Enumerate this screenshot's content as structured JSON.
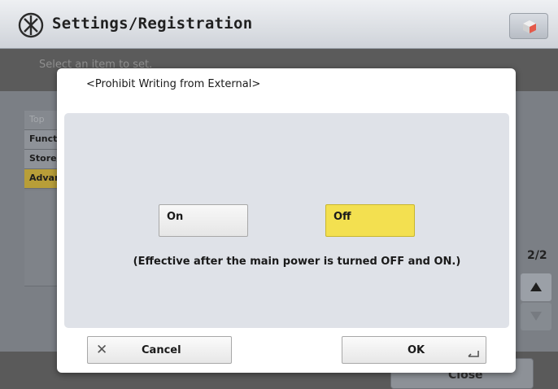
{
  "header": {
    "title": "Settings/Registration",
    "icon": "settings-registration-icon",
    "right_button_icon": "cube-icon"
  },
  "subheader": {
    "text": "Select an item to set."
  },
  "breadcrumbs": [
    {
      "label": "Top"
    },
    {
      "label": "Function Settings"
    },
    {
      "label": "Store/Access Files"
    },
    {
      "label": "Advanced Box"
    }
  ],
  "pagination": {
    "indicator": "2/2"
  },
  "footer": {
    "close_label": "Close"
  },
  "dialog": {
    "title": "<Prohibit Writing from External>",
    "options": [
      {
        "label": "On",
        "selected": false
      },
      {
        "label": "Off",
        "selected": true
      }
    ],
    "note": "(Effective after the main power is turned OFF and ON.)",
    "cancel_label": "Cancel",
    "ok_label": "OK"
  },
  "colors": {
    "selected_option": "#f3e050",
    "active_breadcrumb": "#b89e38",
    "dialog_body": "#dfe2e8"
  }
}
